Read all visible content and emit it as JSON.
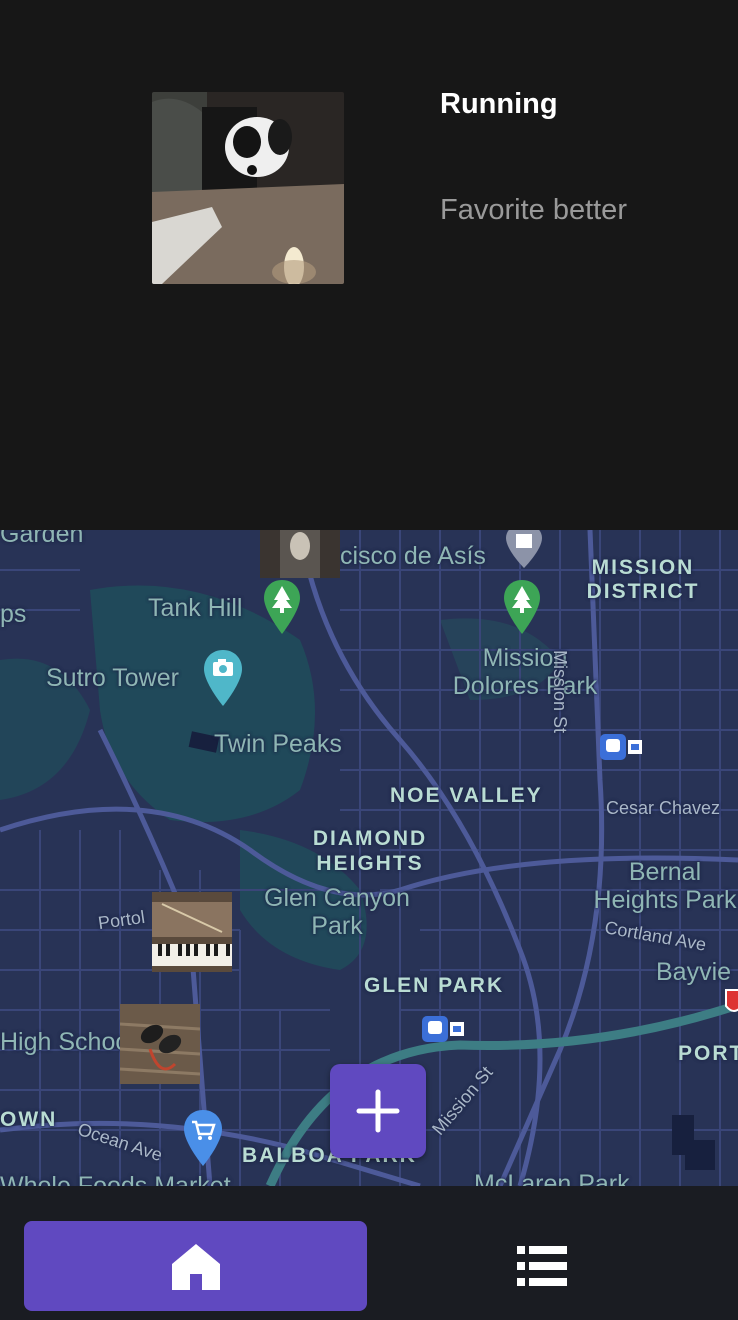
{
  "item": {
    "title": "Running",
    "description": "Favorite better"
  },
  "map": {
    "labels": {
      "garden": "Garden",
      "mission_san_francisco": "Mission San Francisco de Asís",
      "ps": "ps",
      "tank_hill": "Tank Hill",
      "mission_district": "MISSION DISTRICT",
      "sutro_tower": "Sutro Tower",
      "mission_dolores_park": "Mission Dolores Park",
      "mission_st": "Mission St",
      "twin_peaks": "Twin Peaks",
      "noe_valley": "NOE VALLEY",
      "cesar_chavez": "Cesar Chavez",
      "diamond_heights": "DIAMOND HEIGHTS",
      "glen_canyon_park": "Glen Canyon Park",
      "bernal_heights_park": "Bernal Heights Park",
      "portola": "Portol",
      "cortland_ave": "Cortland Ave",
      "bayview": "Bayvie",
      "glen_park": "GLEN PARK",
      "high_school": "High Schoo",
      "portola_caps": "PORT",
      "town": "OWN",
      "ocean_ave": "Ocean Ave",
      "mission_st_2": "Mission St",
      "balboa_park": "BALBOA PARK",
      "whole_foods": "Whole Foods Market",
      "mclaren_park": "McLaren Park"
    }
  },
  "colors": {
    "accent": "#6049c0",
    "background": "#171717",
    "map_base": "#283356",
    "park_pin": "#3da556",
    "camera_pin": "#4fb7c9",
    "shop_pin": "#4a8fe8"
  },
  "icons": {
    "fab": "plus-icon",
    "home": "home-icon",
    "list": "list-icon"
  }
}
